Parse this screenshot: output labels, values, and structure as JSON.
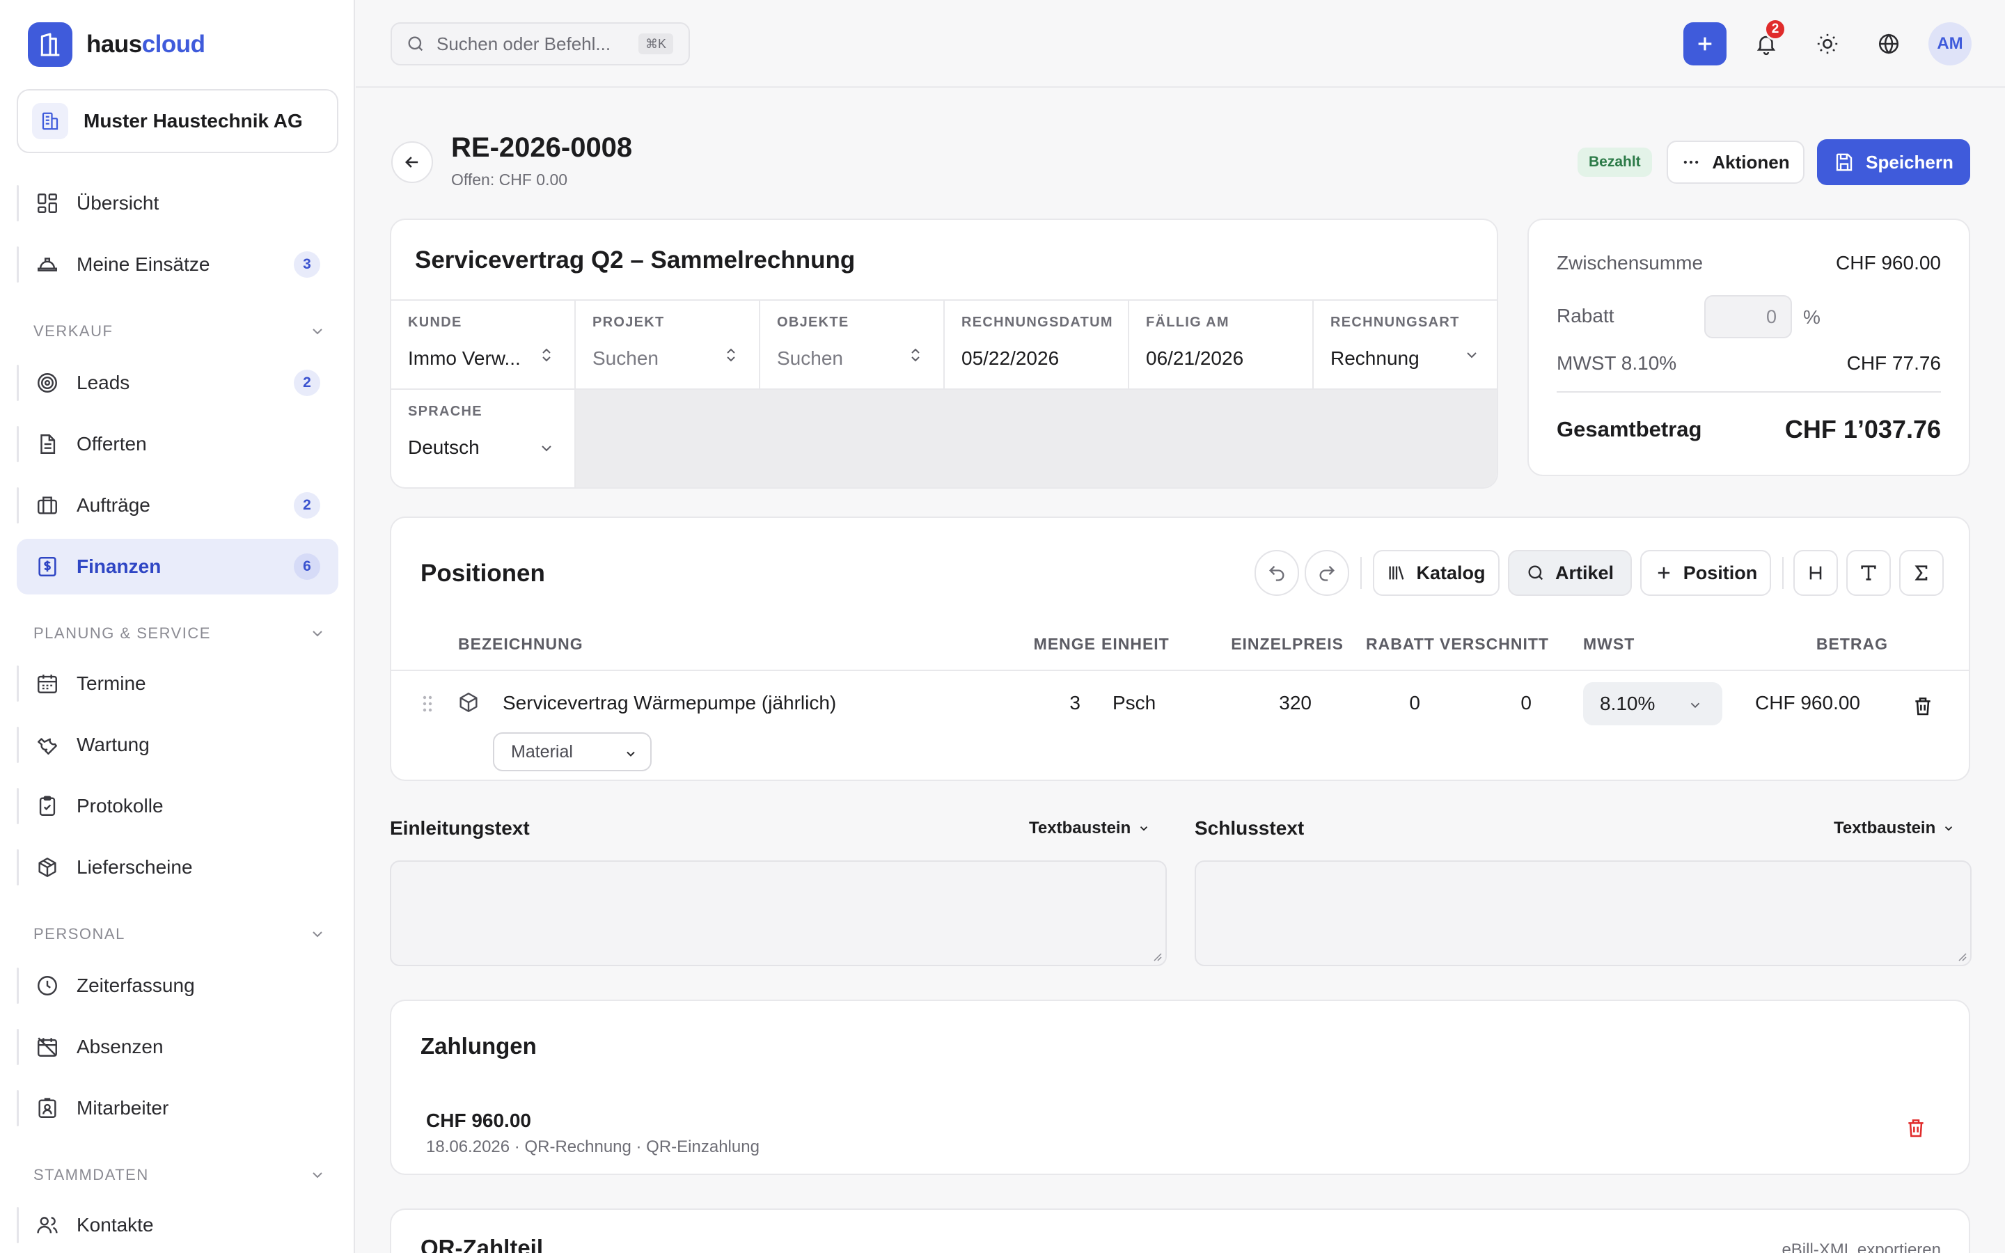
{
  "brand": {
    "name_part1": "haus",
    "name_part2": "cloud",
    "accent": "#3f5bdb"
  },
  "company": {
    "name": "Muster Haustechnik AG"
  },
  "sidebar": {
    "items": [
      {
        "label": "Übersicht",
        "icon": "grid-icon"
      },
      {
        "label": "Meine Einsätze",
        "icon": "helmet-icon",
        "badge": "3"
      },
      {
        "label": "Leads",
        "icon": "target-icon",
        "badge": "2"
      },
      {
        "label": "Offerten",
        "icon": "document-icon"
      },
      {
        "label": "Aufträge",
        "icon": "briefcase-icon",
        "badge": "2"
      },
      {
        "label": "Finanzen",
        "icon": "receipt-icon",
        "badge": "6",
        "active": true
      },
      {
        "label": "Termine",
        "icon": "calendar-icon"
      },
      {
        "label": "Wartung",
        "icon": "wrench-icon"
      },
      {
        "label": "Protokolle",
        "icon": "clipboard-check-icon"
      },
      {
        "label": "Lieferscheine",
        "icon": "package-icon"
      },
      {
        "label": "Zeiterfassung",
        "icon": "clock-icon"
      },
      {
        "label": "Absenzen",
        "icon": "calendar-off-icon"
      },
      {
        "label": "Mitarbeiter",
        "icon": "id-badge-icon"
      },
      {
        "label": "Kontakte",
        "icon": "users-icon"
      }
    ],
    "sections": [
      "VERKAUF",
      "PLANUNG & SERVICE",
      "PERSONAL",
      "STAMMDATEN"
    ]
  },
  "topbar": {
    "search_placeholder": "Suchen oder Befehl...",
    "shortcut": "⌘K",
    "notifications": "2",
    "avatar": "AM"
  },
  "header": {
    "title": "RE-2026-0008",
    "subtitle": "Offen: CHF 0.00",
    "status": "Bezahlt",
    "actions_label": "Aktionen",
    "save_label": "Speichern"
  },
  "invoice": {
    "title": "Servicevertrag Q2 – Sammelrechnung",
    "fields": [
      {
        "label": "KUNDE",
        "value": "Immo Verw...",
        "muted": false
      },
      {
        "label": "PROJEKT",
        "value": "Suchen",
        "muted": true
      },
      {
        "label": "OBJEKTE",
        "value": "Suchen",
        "muted": true
      },
      {
        "label": "RECHNUNGSDATUM",
        "value": "05/22/2026"
      },
      {
        "label": "FÄLLIG AM",
        "value": "06/21/2026"
      },
      {
        "label": "RECHNUNGSART",
        "value": "Rechnung"
      }
    ],
    "language": {
      "label": "SPRACHE",
      "value": "Deutsch"
    }
  },
  "summary": {
    "subtotal_label": "Zwischensumme",
    "subtotal": "CHF 960.00",
    "discount_label": "Rabatt",
    "discount_value": "0",
    "discount_unit": "%",
    "vat_label": "MWST 8.10%",
    "vat": "CHF 77.76",
    "total_label": "Gesamtbetrag",
    "total": "CHF 1’037.76"
  },
  "positions": {
    "title": "Positionen",
    "toolbar": {
      "katalog": "Katalog",
      "artikel": "Artikel",
      "position": "Position"
    },
    "headers": {
      "name": "BEZEICHNUNG",
      "qty": "MENGE",
      "unit": "EINHEIT",
      "price": "EINZELPREIS",
      "discount": "RABATT",
      "waste": "VERSCHNITT",
      "vat": "MWST",
      "amount": "BETRAG"
    },
    "rows": [
      {
        "name": "Servicevertrag Wärmepumpe (jährlich)",
        "qty": "3",
        "unit": "Psch",
        "price": "320",
        "discount": "0",
        "waste": "0",
        "vat": "8.10%",
        "amount": "CHF 960.00",
        "type": "Material"
      }
    ]
  },
  "texts": {
    "intro_label": "Einleitungstext",
    "closing_label": "Schlusstext",
    "template_label": "Textbaustein"
  },
  "payments": {
    "title": "Zahlungen",
    "items": [
      {
        "amount": "CHF 960.00",
        "meta": "18.06.2026 · QR-Rechnung · QR-Einzahlung"
      }
    ]
  },
  "qr": {
    "title": "QR-Zahlteil",
    "export_label": "eBill-XML exportieren"
  }
}
